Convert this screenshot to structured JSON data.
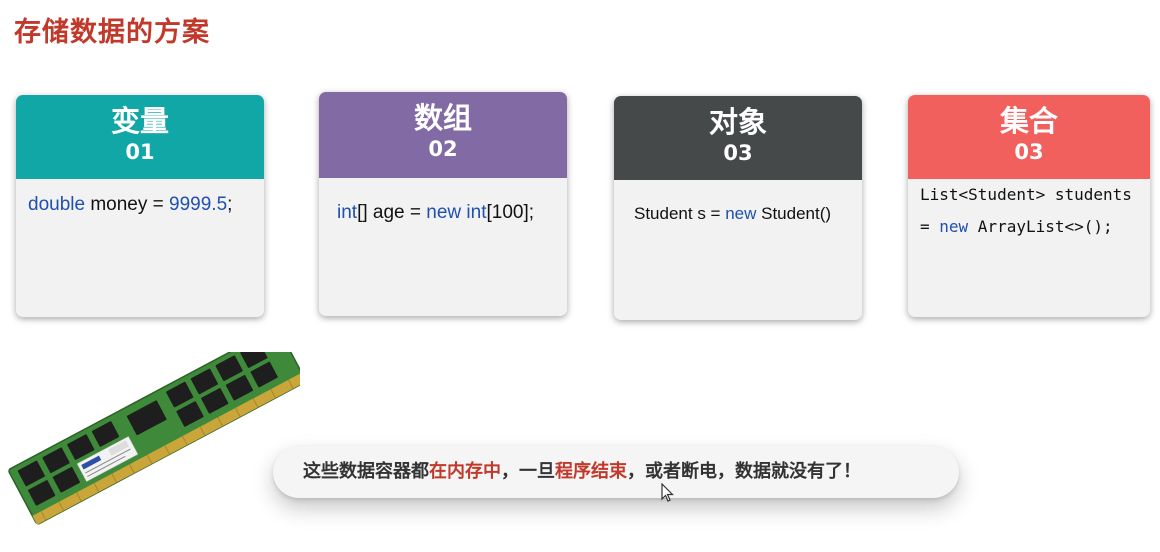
{
  "title": "存储数据的方案",
  "cards": [
    {
      "name": "变量",
      "num": "01",
      "color": "#12a7a7",
      "code": {
        "t1": "double",
        "t2": " money = ",
        "t3": "9999.5",
        "t4": ";"
      }
    },
    {
      "name": "数组",
      "num": "02",
      "color": "#826aa4",
      "code": {
        "t1": "int",
        "t2": "[] age = ",
        "t3": "new",
        "t4": " ",
        "t5": "int",
        "t6": "[100];"
      }
    },
    {
      "name": "对象",
      "num": "03",
      "color": "#45494a",
      "code": {
        "t1": "Student s = ",
        "t2": "new",
        "t3": " Student()"
      }
    },
    {
      "name": "集合",
      "num": "03",
      "color": "#f2605e",
      "code": {
        "l1": "List<Student> students",
        "l2a": "= ",
        "l2b": "new",
        "l2c": " ArrayList<>();"
      }
    }
  ],
  "note": {
    "p1": "这些数据容器都",
    "p2": "在内存中",
    "p3": "，一旦",
    "p4": "程序结束",
    "p5": "，或者断电，数据就没有了！"
  },
  "colors": {
    "title": "#c0392b",
    "highlight": "#c0392b",
    "keyword": "#1f4fb0"
  },
  "image": {
    "name": "ram-memory-module"
  }
}
